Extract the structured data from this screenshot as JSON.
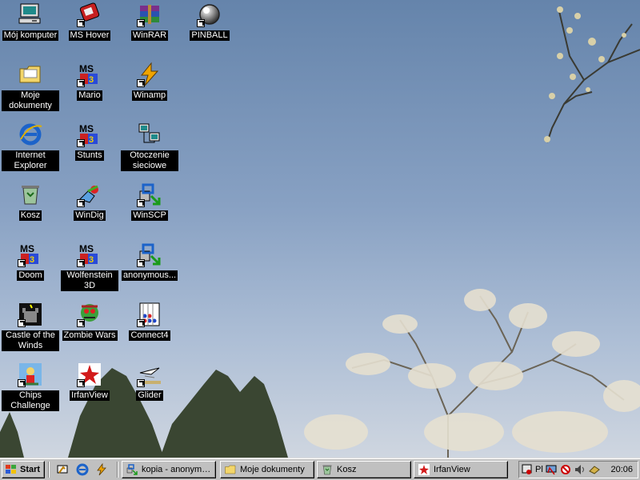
{
  "desktop": {
    "icons": [
      {
        "label": "Mój komputer",
        "icon": "my-computer-icon"
      },
      {
        "label": "MS Hover",
        "icon": "ms-hover-icon"
      },
      {
        "label": "WinRAR",
        "icon": "winrar-icon"
      },
      {
        "label": "PINBALL",
        "icon": "pinball-icon"
      },
      {
        "label": "Moje dokumenty",
        "icon": "my-documents-folder-icon"
      },
      {
        "label": "Mario",
        "icon": "ms-dos-icon"
      },
      {
        "label": "Winamp",
        "icon": "winamp-icon"
      },
      {
        "label": "Internet Explorer",
        "icon": "internet-explorer-icon"
      },
      {
        "label": "Stunts",
        "icon": "ms-dos-icon"
      },
      {
        "label": "Otoczenie sieciowe",
        "icon": "network-neighborhood-icon"
      },
      {
        "label": "Kosz",
        "icon": "recycle-bin-icon"
      },
      {
        "label": "WinDig",
        "icon": "windig-icon"
      },
      {
        "label": "WinSCP",
        "icon": "winscp-icon"
      },
      {
        "label": "Doom",
        "icon": "ms-dos-icon"
      },
      {
        "label": "Wolfenstein 3D",
        "icon": "ms-dos-icon"
      },
      {
        "label": "anonymous...",
        "icon": "winscp-icon"
      },
      {
        "label": "Castle of the Winds",
        "icon": "castle-icon"
      },
      {
        "label": "Zombie Wars",
        "icon": "zombie-icon"
      },
      {
        "label": "Connect4",
        "icon": "connect4-icon"
      },
      {
        "label": "Chips Challenge",
        "icon": "chips-icon"
      },
      {
        "label": "IrfanView",
        "icon": "irfanview-icon"
      },
      {
        "label": "Glider",
        "icon": "glider-icon"
      }
    ]
  },
  "taskbar": {
    "start_label": "Start",
    "quick_launch": [
      "show-desktop-icon",
      "internet-explorer-icon",
      "winamp-icon"
    ],
    "tasks": [
      {
        "label": "kopia - anonymou...",
        "icon": "winscp-icon"
      },
      {
        "label": "Moje dokumenty",
        "icon": "folder-icon"
      },
      {
        "label": "Kosz",
        "icon": "recycle-bin-icon"
      },
      {
        "label": "IrfanView",
        "icon": "irfanview-icon"
      }
    ],
    "tray": {
      "language": "Pl",
      "clock": "20:06"
    }
  }
}
